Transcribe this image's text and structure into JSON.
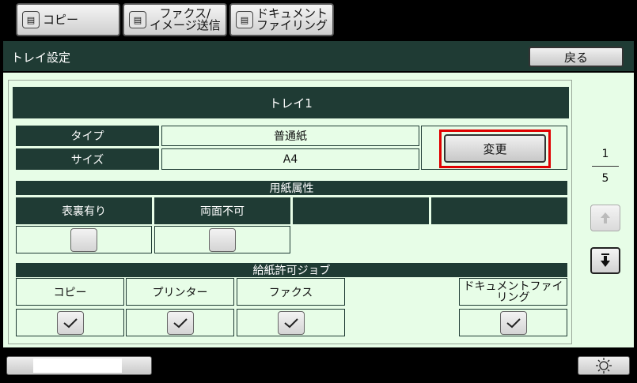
{
  "tabs": [
    {
      "label": "コピー",
      "icon": "copy-icon"
    },
    {
      "label_line1": "ファクス/",
      "label_line2": "イメージ送信",
      "icon": "fax-icon"
    },
    {
      "label_line1": "ドキュメント",
      "label_line2": "ファイリング",
      "icon": "document-filing-icon"
    }
  ],
  "header": {
    "title": "トレイ設定",
    "back_label": "戻る"
  },
  "tray": {
    "title": "トレイ1",
    "type_label": "タイプ",
    "type_value": "普通紙",
    "size_label": "サイズ",
    "size_value": "A4",
    "change_label": "変更"
  },
  "paper_attributes": {
    "title": "用紙属性",
    "columns": [
      "表裏有り",
      "両面不可",
      "",
      ""
    ],
    "checked": [
      false,
      false
    ]
  },
  "allowed_jobs": {
    "title": "給紙許可ジョブ",
    "columns": [
      "コピー",
      "プリンター",
      "ファクス",
      "",
      "ドキュメントファイリング"
    ],
    "checked": [
      true,
      true,
      true,
      true
    ]
  },
  "pager": {
    "current": "1",
    "total": "5"
  },
  "colors": {
    "dark": "#1f3b34",
    "background": "#e7fde7",
    "highlight": "#e00000"
  }
}
